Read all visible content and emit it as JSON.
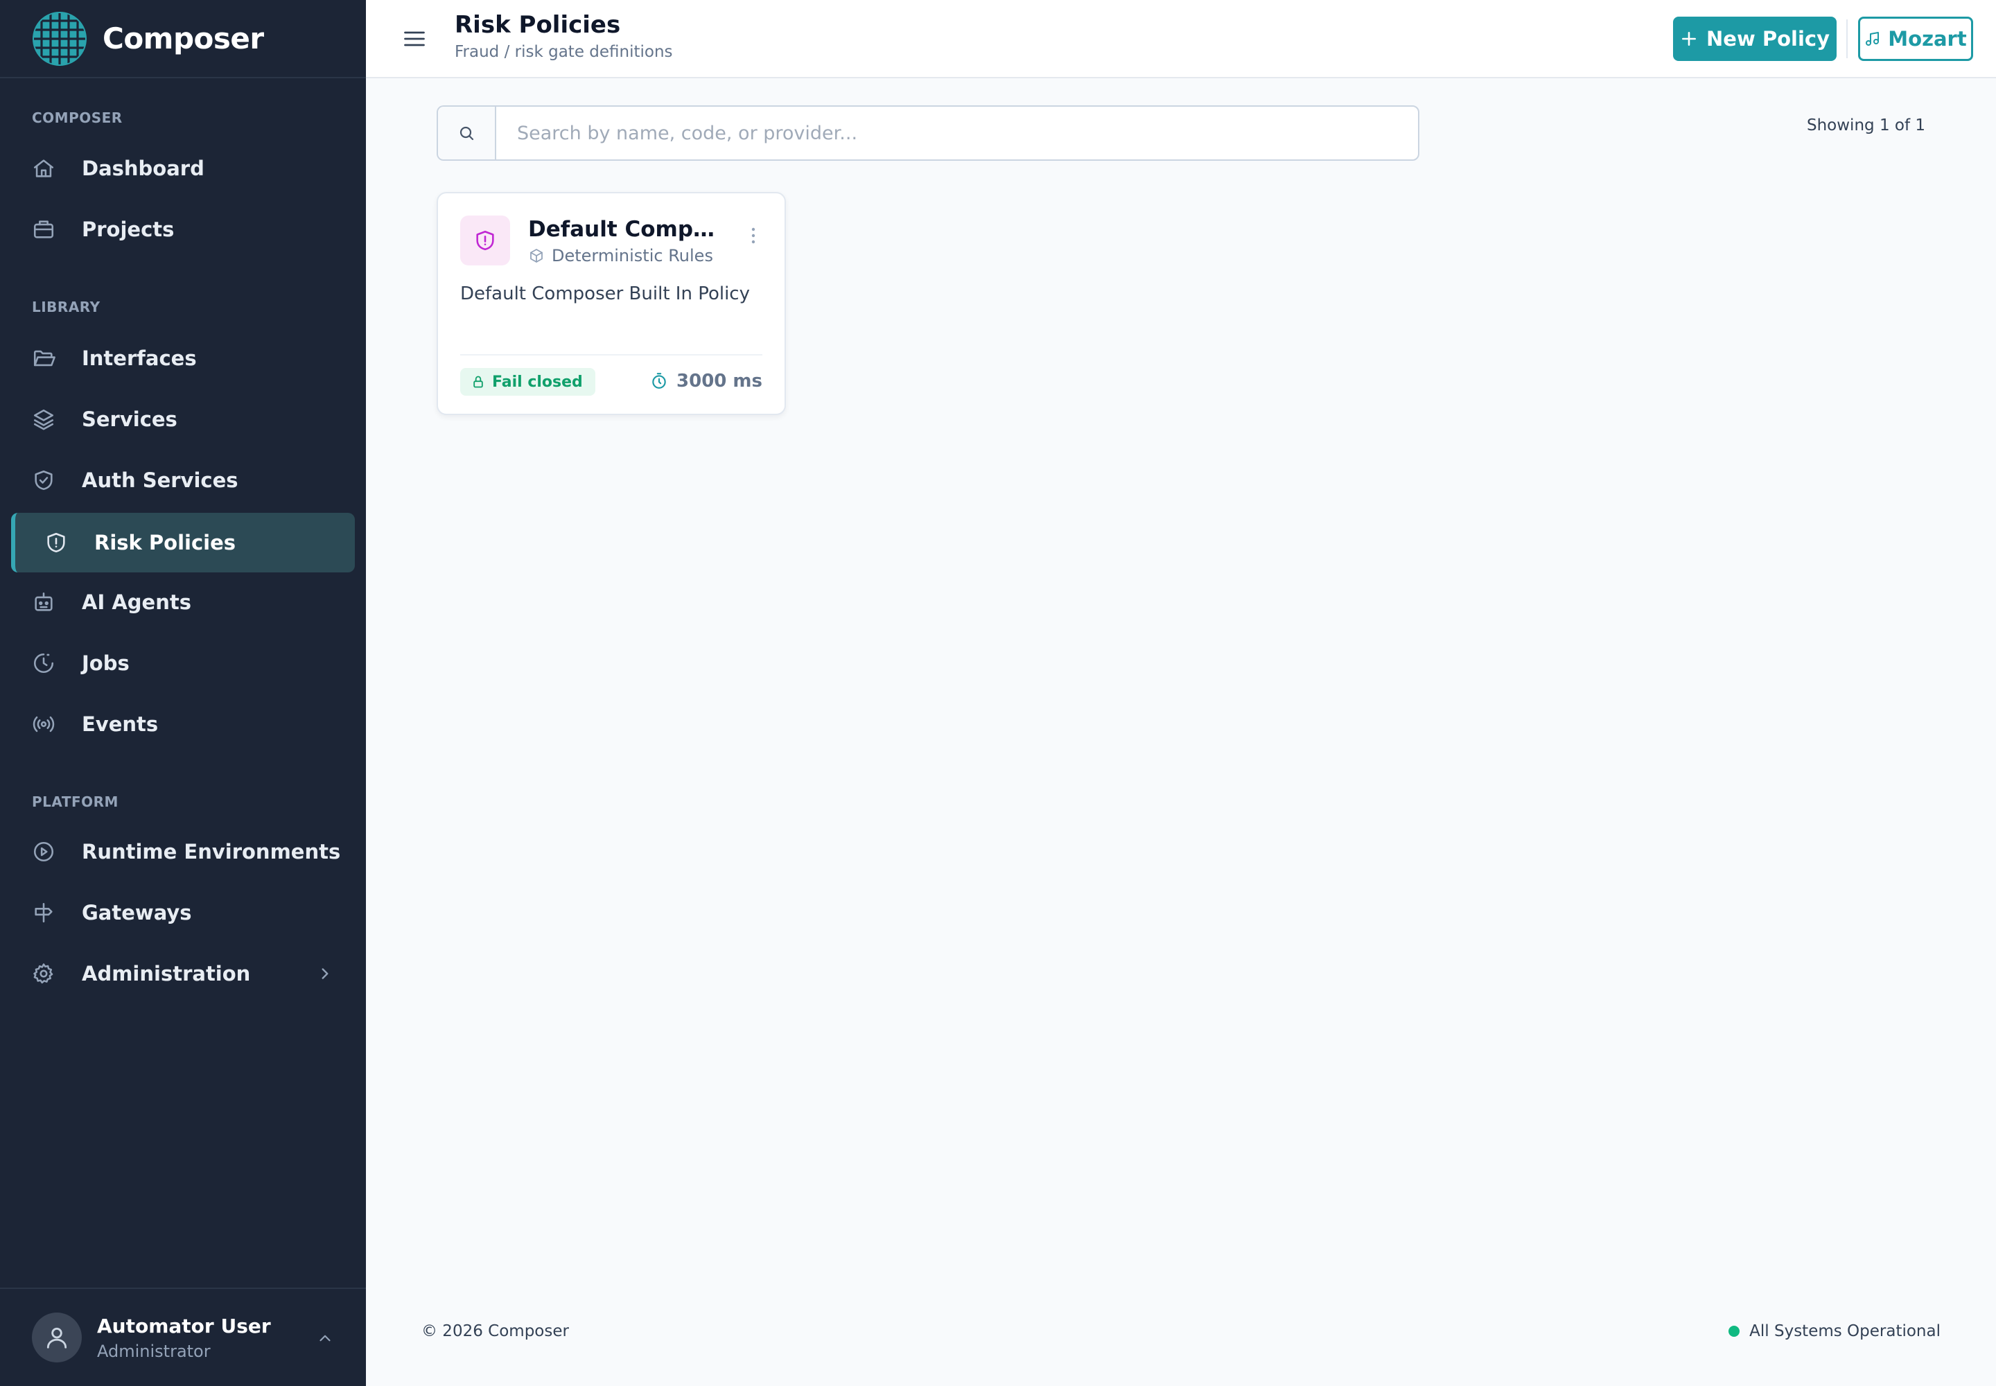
{
  "brand": {
    "name": "Composer"
  },
  "sidebar": {
    "sections": {
      "composer": "COMPOSER",
      "library": "LIBRARY",
      "platform": "PLATFORM"
    },
    "items": [
      {
        "label": "Dashboard",
        "icon": "home-icon"
      },
      {
        "label": "Projects",
        "icon": "briefcase-icon"
      },
      {
        "label": "Interfaces",
        "icon": "folder-open-icon"
      },
      {
        "label": "Services",
        "icon": "layers-icon"
      },
      {
        "label": "Auth Services",
        "icon": "shield-check-icon"
      },
      {
        "label": "Risk Policies",
        "icon": "shield-alert-icon",
        "active": true
      },
      {
        "label": "AI Agents",
        "icon": "bot-icon"
      },
      {
        "label": "Jobs",
        "icon": "clock-icon"
      },
      {
        "label": "Events",
        "icon": "broadcast-icon"
      },
      {
        "label": "Runtime Environments",
        "icon": "play-circle-icon"
      },
      {
        "label": "Gateways",
        "icon": "signpost-icon"
      },
      {
        "label": "Administration",
        "icon": "gear-icon"
      }
    ]
  },
  "user": {
    "name": "Automator User",
    "role": "Administrator"
  },
  "header": {
    "title": "Risk Policies",
    "subtitle": "Fraud / risk gate definitions",
    "new_button": "New Policy",
    "mozart_button": "Mozart"
  },
  "search": {
    "placeholder": "Search by name, code, or provider...",
    "value": ""
  },
  "results": {
    "showing": "Showing 1 of 1"
  },
  "policies": [
    {
      "title": "Default Compos...",
      "type": "Deterministic Rules",
      "description": "Default Composer Built In Policy",
      "badge": "Fail closed",
      "timeout": "3000 ms"
    }
  ],
  "footer": {
    "copyright": "© 2026 Composer",
    "status": "All Systems Operational"
  },
  "colors": {
    "sidebar_bg": "#1c2536",
    "accent": "#1d9aa5",
    "active_item_bg": "#2c4a55",
    "success": "#10b981",
    "policy_icon": "#c026d3"
  }
}
